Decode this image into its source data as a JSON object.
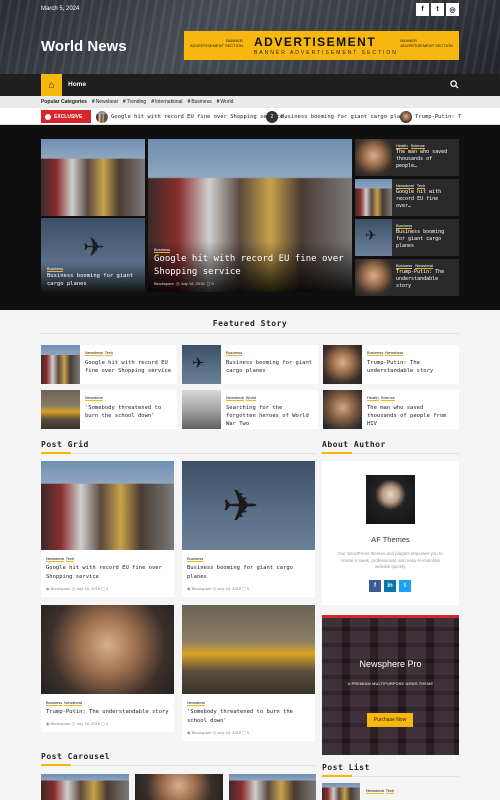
{
  "header": {
    "date": "March 5, 2024",
    "socials": [
      "f",
      "t",
      "ig"
    ],
    "logo": "World News"
  },
  "ad": {
    "left_lines": [
      "BANNER",
      "ADVERTISEMENT SECTION"
    ],
    "main": "ADVERTISEMENT",
    "sub": "BANNER ADVERTISEMENT SECTION",
    "right_lines": [
      "BANNER",
      "ADVERTISEMENT SECTION"
    ]
  },
  "nav": {
    "home": "Home"
  },
  "categories": {
    "label": "Popular Categories",
    "items": [
      "Newsbeat",
      "Trending",
      "International",
      "Business",
      "World"
    ]
  },
  "ticker": {
    "label": "EXCLUSIVE",
    "items": [
      "Google hit with record EU fine over Shopping service",
      "Business booming for giant cargo planes",
      "Trump-Putin: T"
    ],
    "num": "2"
  },
  "hero": {
    "main": {
      "cat": "Business",
      "title": "Google hit with record EU fine over Shopping service",
      "by": "Blockspare",
      "date": "July 18, 2018",
      "comments": "0"
    },
    "left_bottom": {
      "cat": "Business",
      "title": "Business booming for giant cargo planes"
    },
    "side": [
      {
        "cats": [
          "Health",
          "Science"
        ],
        "title": "The man who saved thousands of people…"
      },
      {
        "cats": [
          "Newsbeat",
          "Tech"
        ],
        "title": "Google hit with record EU fine over…"
      },
      {
        "cats": [
          "Business"
        ],
        "title": "Business booming for giant cargo planes"
      },
      {
        "cats": [
          "Business",
          "Newsbeat"
        ],
        "title": "Trump-Putin: The understandable story"
      }
    ]
  },
  "featured": {
    "title": "Featured Story",
    "items": [
      {
        "cats": [
          "Newsbeat",
          "Tech"
        ],
        "title": "Google hit with record EU fine over Shopping service"
      },
      {
        "cats": [
          "Business"
        ],
        "title": "Business booming for giant cargo planes"
      },
      {
        "cats": [
          "Business",
          "Newsbeat"
        ],
        "title": "Trump-Putin: The understandable story"
      },
      {
        "cats": [
          "Newsbeat"
        ],
        "title": "'Somebody threatened to burn the school down'"
      },
      {
        "cats": [
          "Newsbeat",
          "World"
        ],
        "title": "Searching for the forgotten heroes of World War Two"
      },
      {
        "cats": [
          "Health",
          "Science"
        ],
        "title": "The man who saved thousands of people from HIV"
      }
    ]
  },
  "post_grid": {
    "title": "Post Grid",
    "cards": [
      {
        "cats": [
          "Newsbeat",
          "Tech"
        ],
        "title": "Google hit with record EU fine over Shopping service",
        "by": "Blockspare",
        "date": "July 18, 2018",
        "comments": "0"
      },
      {
        "cats": [
          "Business"
        ],
        "title": "Business booming for giant cargo planes",
        "by": "Blockspare",
        "date": "July 18, 2018",
        "comments": "0"
      },
      {
        "cats": [
          "Business",
          "Newsbeat"
        ],
        "title": "Trump-Putin: The understandable story",
        "by": "Blockspare",
        "date": "July 18, 2018",
        "comments": "0"
      },
      {
        "cats": [
          "Newsbeat"
        ],
        "title": "'Somebody threatened to burn the school down'",
        "by": "Blockspare",
        "date": "July 18, 2018",
        "comments": "0"
      }
    ]
  },
  "about": {
    "title": "About Author",
    "name": "AF Themes",
    "bio": "Our WordPress themes and plugins empower you to create a sleek, professional, and easy-to-maintain website quickly.",
    "socials": [
      "f",
      "in",
      "t"
    ]
  },
  "promo": {
    "title": "Newsphere Pro",
    "sub": "A PREMIUM MULTIPURPOSE NEWS THEME",
    "button": "Purchase Now"
  },
  "carousel": {
    "title": "Post Carousel"
  },
  "post_list": {
    "title": "Post List",
    "first_cats": [
      "Newsbeat",
      "Tech"
    ]
  },
  "colors": {
    "accent": "#f8b70f",
    "exclusive": "#d6252b",
    "dark": "#1f1f1f"
  }
}
